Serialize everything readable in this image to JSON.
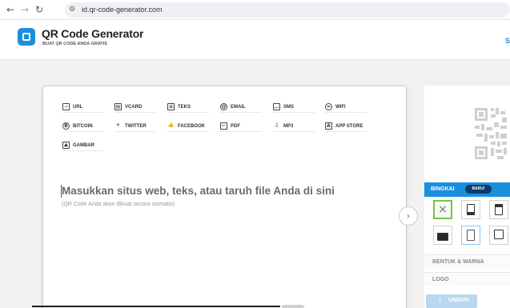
{
  "browser": {
    "url": "id.qr-code-generator.com",
    "icons": {
      "back": "arrow-left-icon",
      "forward": "arrow-right-icon",
      "reload": "reload-icon",
      "site_info": "site-info-icon"
    }
  },
  "header": {
    "brand": "QR Code Generator",
    "tagline": "BUAT QR CODE ANDA GRATIS",
    "brand_color": "#1b8fdc",
    "right_link": "S"
  },
  "tabs": [
    {
      "id": "url",
      "label": "URL",
      "icon": "link-box-icon"
    },
    {
      "id": "vcard",
      "label": "VCARD",
      "icon": "contact-card-icon"
    },
    {
      "id": "teks",
      "label": "TEKS",
      "icon": "text-document-icon"
    },
    {
      "id": "email",
      "label": "EMAIL",
      "icon": "at-sign-icon"
    },
    {
      "id": "sms",
      "label": "SMS",
      "icon": "message-icon"
    },
    {
      "id": "wifi",
      "label": "WIFI",
      "icon": "wifi-icon"
    },
    {
      "id": "bitcoin",
      "label": "BITCOIN",
      "icon": "bitcoin-icon"
    },
    {
      "id": "twitter",
      "label": "TWITTER",
      "icon": "twitter-icon"
    },
    {
      "id": "facebook",
      "label": "FACEBOOK",
      "icon": "thumbs-up-icon"
    },
    {
      "id": "pdf",
      "label": "PDF",
      "icon": "pdf-file-icon"
    },
    {
      "id": "mp3",
      "label": "MP3",
      "icon": "music-note-icon"
    },
    {
      "id": "appstore",
      "label": "APP STORE",
      "icon": "app-store-icon"
    },
    {
      "id": "gambar",
      "label": "GAMBAR",
      "icon": "image-icon"
    }
  ],
  "input": {
    "prompt": "Masukkan situs web, teks, atau taruh file Anda di sini",
    "hint": "(QR Code Anda akan dibuat secara otomatis)"
  },
  "panel": {
    "frame_title": "BINGKAI",
    "new_badge": "BARU!",
    "shape_color": "BENTUK & WARNA",
    "logo": "LOGO",
    "download": "UNDUH",
    "selected_frame": "none",
    "accent": "#1b8fdc",
    "selected_border": "#7cc14a"
  }
}
